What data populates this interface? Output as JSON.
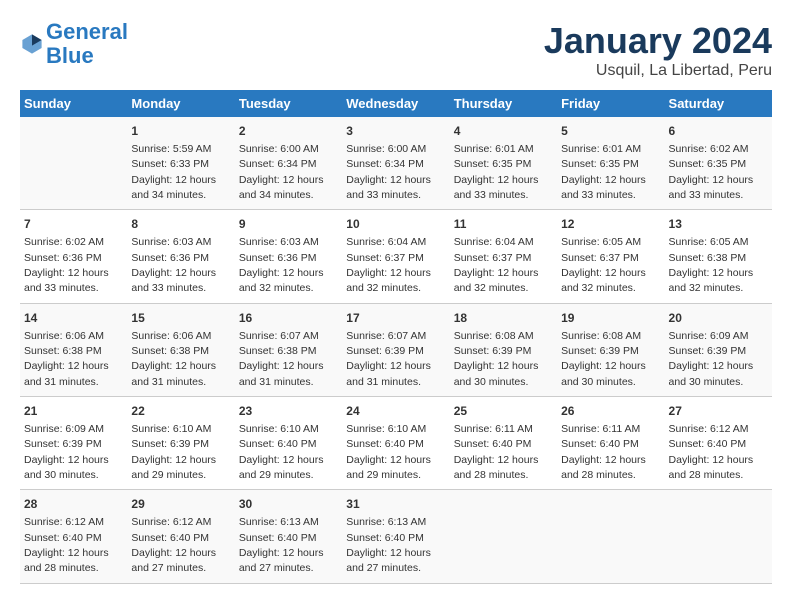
{
  "header": {
    "logo_line1": "General",
    "logo_line2": "Blue",
    "main_title": "January 2024",
    "subtitle": "Usquil, La Libertad, Peru"
  },
  "columns": [
    "Sunday",
    "Monday",
    "Tuesday",
    "Wednesday",
    "Thursday",
    "Friday",
    "Saturday"
  ],
  "weeks": [
    [
      {
        "day": "",
        "sunrise": "",
        "sunset": "",
        "daylight": ""
      },
      {
        "day": "1",
        "sunrise": "Sunrise: 5:59 AM",
        "sunset": "Sunset: 6:33 PM",
        "daylight": "Daylight: 12 hours and 34 minutes."
      },
      {
        "day": "2",
        "sunrise": "Sunrise: 6:00 AM",
        "sunset": "Sunset: 6:34 PM",
        "daylight": "Daylight: 12 hours and 34 minutes."
      },
      {
        "day": "3",
        "sunrise": "Sunrise: 6:00 AM",
        "sunset": "Sunset: 6:34 PM",
        "daylight": "Daylight: 12 hours and 33 minutes."
      },
      {
        "day": "4",
        "sunrise": "Sunrise: 6:01 AM",
        "sunset": "Sunset: 6:35 PM",
        "daylight": "Daylight: 12 hours and 33 minutes."
      },
      {
        "day": "5",
        "sunrise": "Sunrise: 6:01 AM",
        "sunset": "Sunset: 6:35 PM",
        "daylight": "Daylight: 12 hours and 33 minutes."
      },
      {
        "day": "6",
        "sunrise": "Sunrise: 6:02 AM",
        "sunset": "Sunset: 6:35 PM",
        "daylight": "Daylight: 12 hours and 33 minutes."
      }
    ],
    [
      {
        "day": "7",
        "sunrise": "Sunrise: 6:02 AM",
        "sunset": "Sunset: 6:36 PM",
        "daylight": "Daylight: 12 hours and 33 minutes."
      },
      {
        "day": "8",
        "sunrise": "Sunrise: 6:03 AM",
        "sunset": "Sunset: 6:36 PM",
        "daylight": "Daylight: 12 hours and 33 minutes."
      },
      {
        "day": "9",
        "sunrise": "Sunrise: 6:03 AM",
        "sunset": "Sunset: 6:36 PM",
        "daylight": "Daylight: 12 hours and 32 minutes."
      },
      {
        "day": "10",
        "sunrise": "Sunrise: 6:04 AM",
        "sunset": "Sunset: 6:37 PM",
        "daylight": "Daylight: 12 hours and 32 minutes."
      },
      {
        "day": "11",
        "sunrise": "Sunrise: 6:04 AM",
        "sunset": "Sunset: 6:37 PM",
        "daylight": "Daylight: 12 hours and 32 minutes."
      },
      {
        "day": "12",
        "sunrise": "Sunrise: 6:05 AM",
        "sunset": "Sunset: 6:37 PM",
        "daylight": "Daylight: 12 hours and 32 minutes."
      },
      {
        "day": "13",
        "sunrise": "Sunrise: 6:05 AM",
        "sunset": "Sunset: 6:38 PM",
        "daylight": "Daylight: 12 hours and 32 minutes."
      }
    ],
    [
      {
        "day": "14",
        "sunrise": "Sunrise: 6:06 AM",
        "sunset": "Sunset: 6:38 PM",
        "daylight": "Daylight: 12 hours and 31 minutes."
      },
      {
        "day": "15",
        "sunrise": "Sunrise: 6:06 AM",
        "sunset": "Sunset: 6:38 PM",
        "daylight": "Daylight: 12 hours and 31 minutes."
      },
      {
        "day": "16",
        "sunrise": "Sunrise: 6:07 AM",
        "sunset": "Sunset: 6:38 PM",
        "daylight": "Daylight: 12 hours and 31 minutes."
      },
      {
        "day": "17",
        "sunrise": "Sunrise: 6:07 AM",
        "sunset": "Sunset: 6:39 PM",
        "daylight": "Daylight: 12 hours and 31 minutes."
      },
      {
        "day": "18",
        "sunrise": "Sunrise: 6:08 AM",
        "sunset": "Sunset: 6:39 PM",
        "daylight": "Daylight: 12 hours and 30 minutes."
      },
      {
        "day": "19",
        "sunrise": "Sunrise: 6:08 AM",
        "sunset": "Sunset: 6:39 PM",
        "daylight": "Daylight: 12 hours and 30 minutes."
      },
      {
        "day": "20",
        "sunrise": "Sunrise: 6:09 AM",
        "sunset": "Sunset: 6:39 PM",
        "daylight": "Daylight: 12 hours and 30 minutes."
      }
    ],
    [
      {
        "day": "21",
        "sunrise": "Sunrise: 6:09 AM",
        "sunset": "Sunset: 6:39 PM",
        "daylight": "Daylight: 12 hours and 30 minutes."
      },
      {
        "day": "22",
        "sunrise": "Sunrise: 6:10 AM",
        "sunset": "Sunset: 6:39 PM",
        "daylight": "Daylight: 12 hours and 29 minutes."
      },
      {
        "day": "23",
        "sunrise": "Sunrise: 6:10 AM",
        "sunset": "Sunset: 6:40 PM",
        "daylight": "Daylight: 12 hours and 29 minutes."
      },
      {
        "day": "24",
        "sunrise": "Sunrise: 6:10 AM",
        "sunset": "Sunset: 6:40 PM",
        "daylight": "Daylight: 12 hours and 29 minutes."
      },
      {
        "day": "25",
        "sunrise": "Sunrise: 6:11 AM",
        "sunset": "Sunset: 6:40 PM",
        "daylight": "Daylight: 12 hours and 28 minutes."
      },
      {
        "day": "26",
        "sunrise": "Sunrise: 6:11 AM",
        "sunset": "Sunset: 6:40 PM",
        "daylight": "Daylight: 12 hours and 28 minutes."
      },
      {
        "day": "27",
        "sunrise": "Sunrise: 6:12 AM",
        "sunset": "Sunset: 6:40 PM",
        "daylight": "Daylight: 12 hours and 28 minutes."
      }
    ],
    [
      {
        "day": "28",
        "sunrise": "Sunrise: 6:12 AM",
        "sunset": "Sunset: 6:40 PM",
        "daylight": "Daylight: 12 hours and 28 minutes."
      },
      {
        "day": "29",
        "sunrise": "Sunrise: 6:12 AM",
        "sunset": "Sunset: 6:40 PM",
        "daylight": "Daylight: 12 hours and 27 minutes."
      },
      {
        "day": "30",
        "sunrise": "Sunrise: 6:13 AM",
        "sunset": "Sunset: 6:40 PM",
        "daylight": "Daylight: 12 hours and 27 minutes."
      },
      {
        "day": "31",
        "sunrise": "Sunrise: 6:13 AM",
        "sunset": "Sunset: 6:40 PM",
        "daylight": "Daylight: 12 hours and 27 minutes."
      },
      {
        "day": "",
        "sunrise": "",
        "sunset": "",
        "daylight": ""
      },
      {
        "day": "",
        "sunrise": "",
        "sunset": "",
        "daylight": ""
      },
      {
        "day": "",
        "sunrise": "",
        "sunset": "",
        "daylight": ""
      }
    ]
  ]
}
